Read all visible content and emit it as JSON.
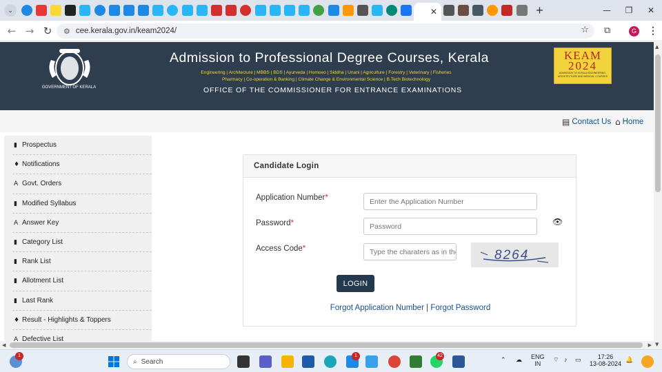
{
  "browser": {
    "tab_icon_colors": [
      "#1e88e5",
      "#e53935",
      "#fdd835",
      "#222222",
      "#29b6f6",
      "#1e88e5",
      "#1e88e5",
      "#1e88e5",
      "#1e88e5",
      "#29b6f6",
      "#29b6f6",
      "#29b6f6",
      "#29b6f6",
      "#d32f2f",
      "#d32f2f",
      "#d32f2f",
      "#29b6f6",
      "#29b6f6",
      "#29b6f6",
      "#29b6f6",
      "#43a047",
      "#1e88e5",
      "#ff9800",
      "#555555",
      "#29b6f6",
      "#00897b",
      "#1877f2",
      "#555555",
      "#6d4c41",
      "#455a64",
      "#ff9800",
      "#c62828",
      "#777777"
    ],
    "url": "cee.kerala.gov.in/keam2024/"
  },
  "header": {
    "title": "Admission to Professional Degree Courses, Kerala",
    "courses_line1": "Engineering | Architecture | MBBS | BDS | Ayurveda | Homoeo | Siddha | Unani | Agriculture | Forestry | Veterinary | Fisheries",
    "courses_line2": "Pharmacy | Co-operation & Banking | Climate Change & Environmental Science | B.Tech Biotechnology",
    "office": "OFFICE OF THE COMMISSIONER FOR ENTRANCE EXAMINATIONS",
    "emblem_caption": "GOVERNMENT OF KERALA",
    "keam_logo": "KEAM",
    "keam_year": "2024",
    "keam_sub": "ADMISSION TO KERALA ENGINEERING, ARCHITECTURE AND MEDICAL COURSES"
  },
  "top_links": {
    "contact": "Contact Us",
    "home": "Home"
  },
  "sidebar": {
    "items": [
      {
        "label": "Prospectus",
        "icon": "file-icon"
      },
      {
        "label": "Notifications",
        "icon": "bell-icon"
      },
      {
        "label": "Govt. Orders",
        "icon": "font-a-icon"
      },
      {
        "label": "Modified Syllabus",
        "icon": "file-icon"
      },
      {
        "label": "Answer Key",
        "icon": "font-a-icon"
      },
      {
        "label": "Category List",
        "icon": "file-icon"
      },
      {
        "label": "Rank List",
        "icon": "file-icon"
      },
      {
        "label": "Allotment List",
        "icon": "file-icon"
      },
      {
        "label": "Last Rank",
        "icon": "file-icon"
      },
      {
        "label": "Result - Highlights & Toppers",
        "icon": "bell-icon"
      },
      {
        "label": "Defective List",
        "icon": "font-a-icon"
      }
    ]
  },
  "login": {
    "heading": "Candidate Login",
    "app_label": "Application Number",
    "app_placeholder": "Enter the Application Number",
    "password_label": "Password",
    "password_placeholder": "Password",
    "access_label": "Access Code",
    "access_placeholder": "Type the charaters as in the image",
    "captcha_text": "8264",
    "button": "LOGIN",
    "forgot_app": "Forgot Application Number",
    "separator": "|",
    "forgot_password": "Forgot Password"
  },
  "taskbar": {
    "search": "Search",
    "lang1": "ENG",
    "lang2": "IN",
    "time": "17:26",
    "date": "13-08-2024",
    "badge_weather": "1",
    "badge_app": "1",
    "badge_whatsapp": "42"
  }
}
